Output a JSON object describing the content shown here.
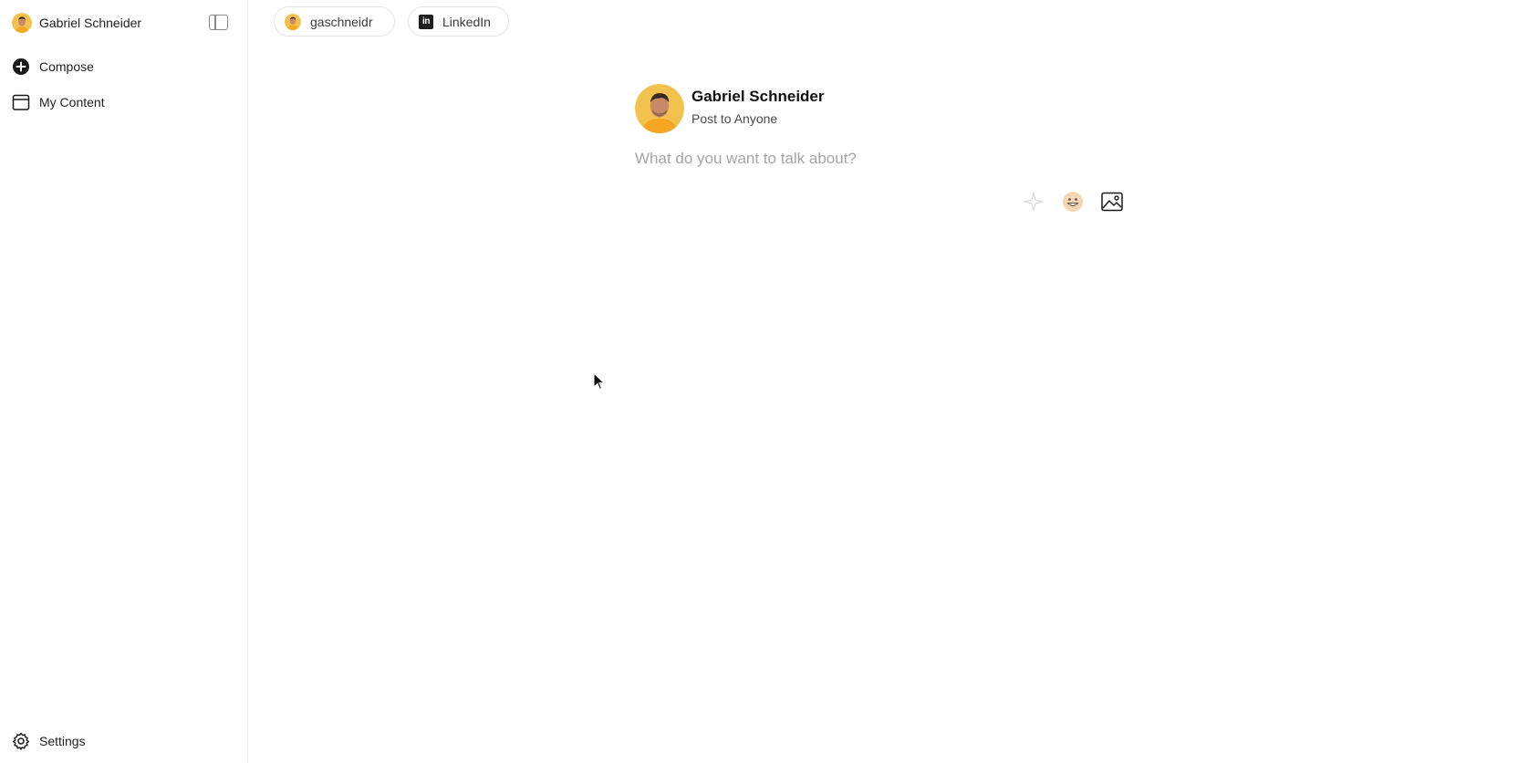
{
  "sidebar": {
    "user_name": "Gabriel Schneider",
    "items": [
      {
        "label": "Compose",
        "icon": "plus-circle-icon"
      },
      {
        "label": "My Content",
        "icon": "calendar-icon"
      }
    ],
    "settings_label": "Settings",
    "toggle_icon": "sidebar-panel-icon"
  },
  "topbar": {
    "account_chip": "gaschneidr",
    "network_chip": "LinkedIn"
  },
  "composer": {
    "author_name": "Gabriel Schneider",
    "audience": "Post to Anyone",
    "placeholder": "What do you want to talk about?",
    "tools": [
      "sparkle-icon",
      "emoji-icon",
      "image-icon"
    ]
  },
  "colors": {
    "avatar_bg": "#f2c14e",
    "avatar_shirt": "#f5a623",
    "text_primary": "#1a1a1a",
    "placeholder": "#a4a4a4",
    "border": "#e2e2e2"
  }
}
